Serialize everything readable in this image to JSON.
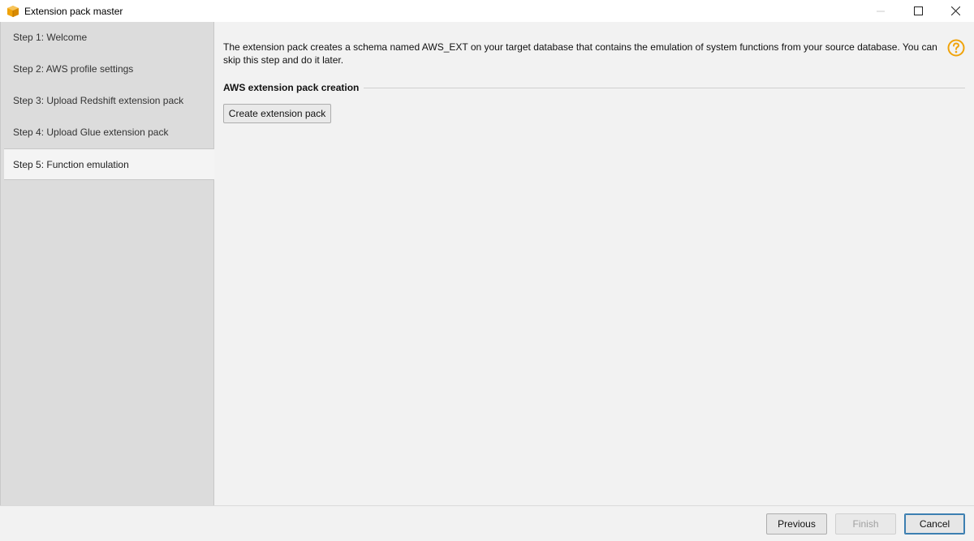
{
  "window": {
    "title": "Extension pack master",
    "app_icon": "aws-box-icon",
    "controls": [
      "minimize-icon",
      "maximize-icon",
      "close-icon"
    ]
  },
  "sidebar": {
    "steps": [
      {
        "label": "Step 1: Welcome",
        "active": false
      },
      {
        "label": "Step 2: AWS profile settings",
        "active": false
      },
      {
        "label": "Step 3: Upload Redshift extension pack",
        "active": false
      },
      {
        "label": "Step 4: Upload Glue extension pack",
        "active": false
      },
      {
        "label": "Step 5: Function emulation",
        "active": true
      }
    ]
  },
  "main": {
    "description": "The extension pack creates a schema named AWS_EXT on your target database that contains the emulation of system functions from your source database. You can skip this step and do it later.",
    "help_icon": "help-question-icon",
    "section_title": "AWS extension pack creation",
    "create_button_label": "Create extension pack"
  },
  "footer": {
    "previous_label": "Previous",
    "finish_label": "Finish",
    "finish_enabled": false,
    "cancel_label": "Cancel"
  },
  "colors": {
    "accent_orange": "#f0a30a",
    "focus_blue": "#3c7fb1",
    "sidebar_bg": "#dcdcdc",
    "content_bg": "#f2f2f2"
  }
}
